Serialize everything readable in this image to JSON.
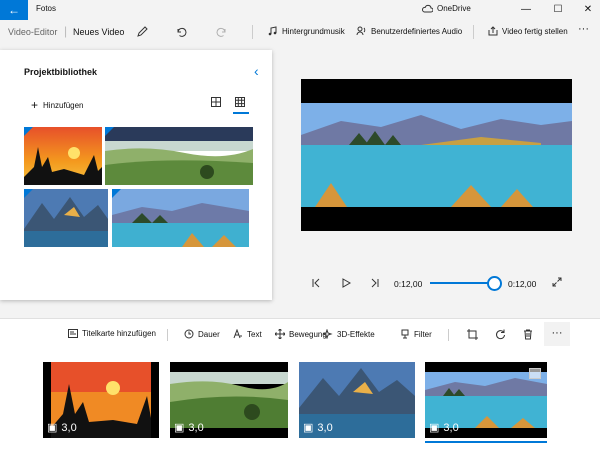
{
  "app": {
    "title": "Fotos",
    "cloud": "OneDrive"
  },
  "window": {
    "minimize": "—",
    "maximize": "☐",
    "close": "✕"
  },
  "breadcrumb": {
    "parent": "Video-Editor",
    "separator": "|",
    "current": "Neues Video"
  },
  "toolbar": {
    "music": "Hintergrundmusik",
    "audio": "Benutzerdefiniertes Audio",
    "finish": "Video fertig stellen",
    "more": "···"
  },
  "library": {
    "title": "Projektbibliothek",
    "add": "Hinzufügen"
  },
  "player": {
    "current_time": "0:12,00",
    "end_time": "0:12,00",
    "progress": 0.92
  },
  "storyboard": {
    "title_card": "Titelkarte hinzufügen",
    "duration": "Dauer",
    "text": "Text",
    "motion": "Bewegung",
    "effects": "3D-Effekte",
    "filter": "Filter",
    "more": "···",
    "clips": [
      {
        "duration": "3,0"
      },
      {
        "duration": "3,0"
      },
      {
        "duration": "3,0"
      },
      {
        "duration": "3,0"
      }
    ]
  }
}
